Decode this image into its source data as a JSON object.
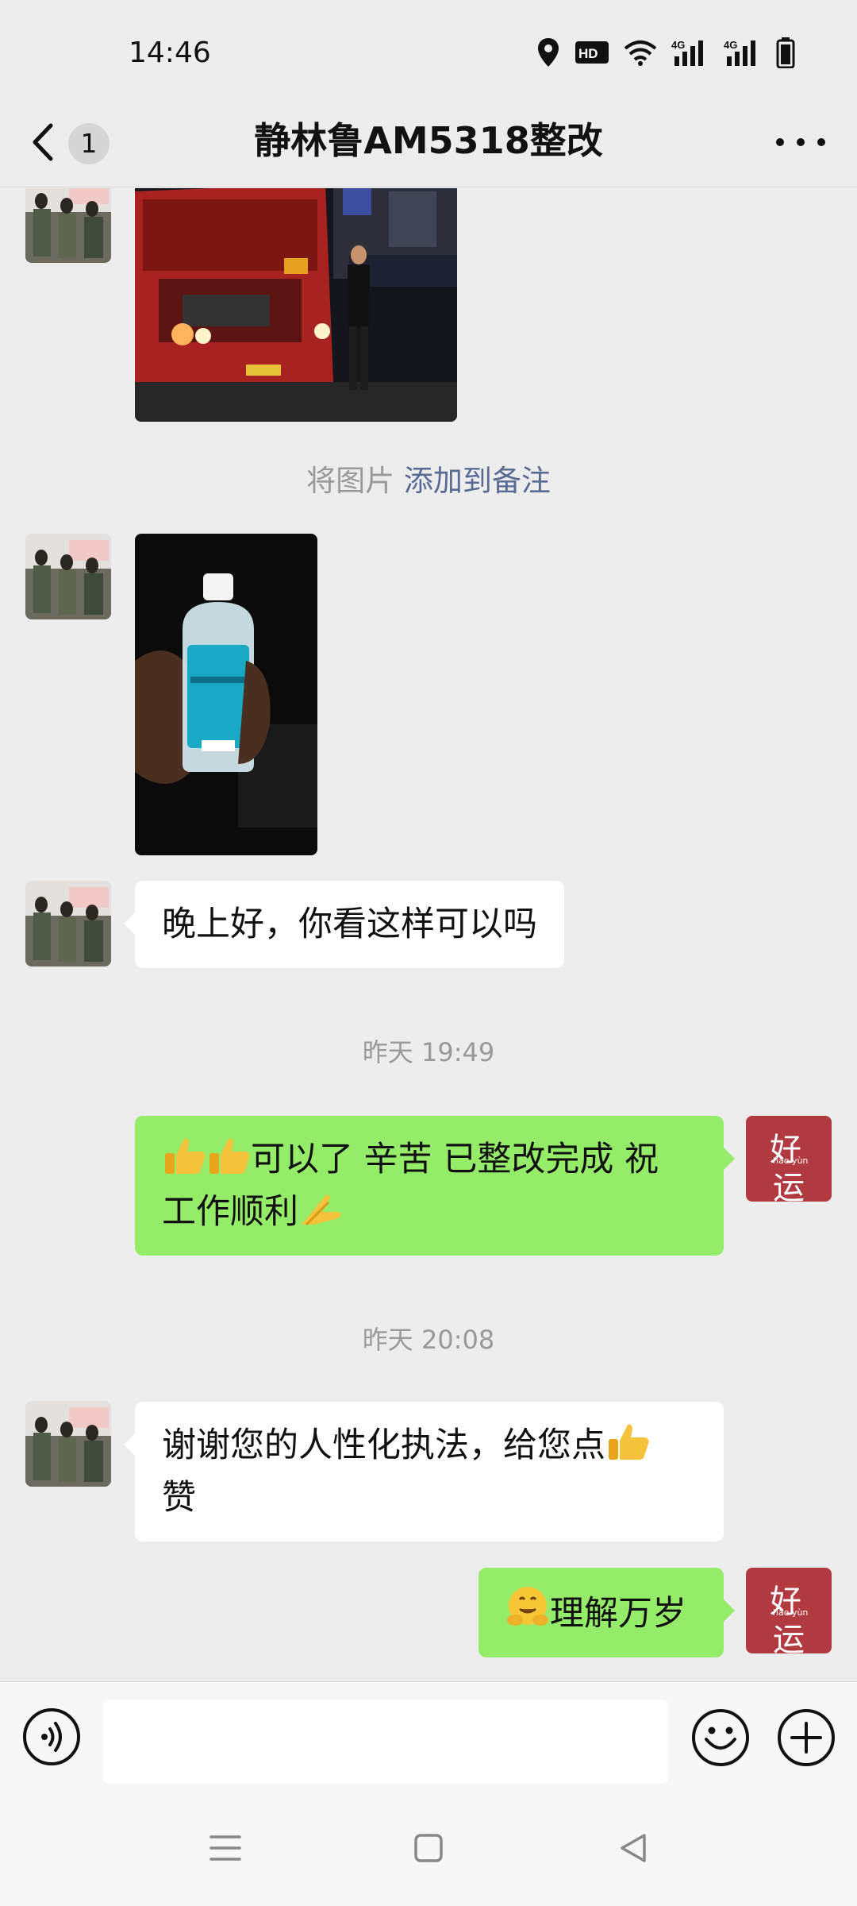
{
  "status": {
    "time": "14:46",
    "icons": [
      "location-icon",
      "hd-icon",
      "wifi-icon",
      "signal-4g-icon",
      "signal-4g-icon",
      "battery-icon"
    ],
    "hd_label": "HD",
    "net_label": "4G"
  },
  "header": {
    "unread_count": "1",
    "title": "静林鲁AM5318整改"
  },
  "messages": {
    "note_prefix": "将图片",
    "note_link": "添加到备注",
    "msg_evening": "晚上好，你看这样可以吗",
    "time1": "昨天 19:49",
    "msg_reply_line1": "可以了 辛苦 已整改完成 祝",
    "msg_reply_line2": "工作顺利",
    "time2": "昨天 20:08",
    "msg_thanks_line1": "谢谢您的人性化执法，给您点",
    "msg_thanks_line2": "赞",
    "msg_understand": "理解万岁"
  },
  "self_avatar": {
    "char_top": "好",
    "pinyin": "hǎo yùn",
    "char_bottom": "运"
  },
  "colors": {
    "background": "#ededed",
    "bubble_out": "#95ec69",
    "bubble_in": "#ffffff",
    "link": "#576b95",
    "self_avatar": "#b03a3f"
  }
}
